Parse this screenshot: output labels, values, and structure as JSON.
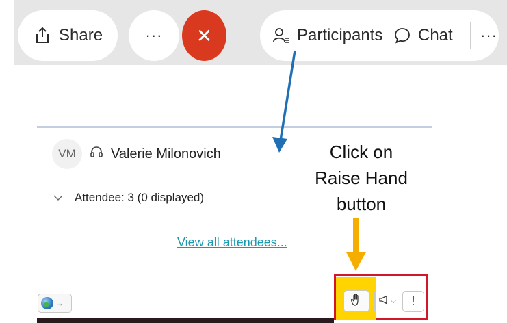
{
  "toolbar": {
    "share_label": "Share",
    "more_label": "···",
    "close_label": "✕",
    "participants_label": "Participants",
    "chat_label": "Chat",
    "more_label_2": "···"
  },
  "panel": {
    "avatar_initials": "VM",
    "participant_name": "Valerie Milonovich",
    "attendee_summary": "Attendee: 3 (0 displayed)",
    "view_all_link": "View all attendees...",
    "alert_label": "!"
  },
  "annotation": {
    "instruction_lines": [
      "Click on",
      "Raise Hand",
      "button"
    ]
  },
  "colors": {
    "close_button": "#d9391e",
    "link": "#1a9ab0",
    "blue_arrow": "#1f6fb5",
    "orange_arrow": "#f5ad00",
    "highlight_yellow": "#ffd400",
    "highlight_red": "#d1182b"
  }
}
